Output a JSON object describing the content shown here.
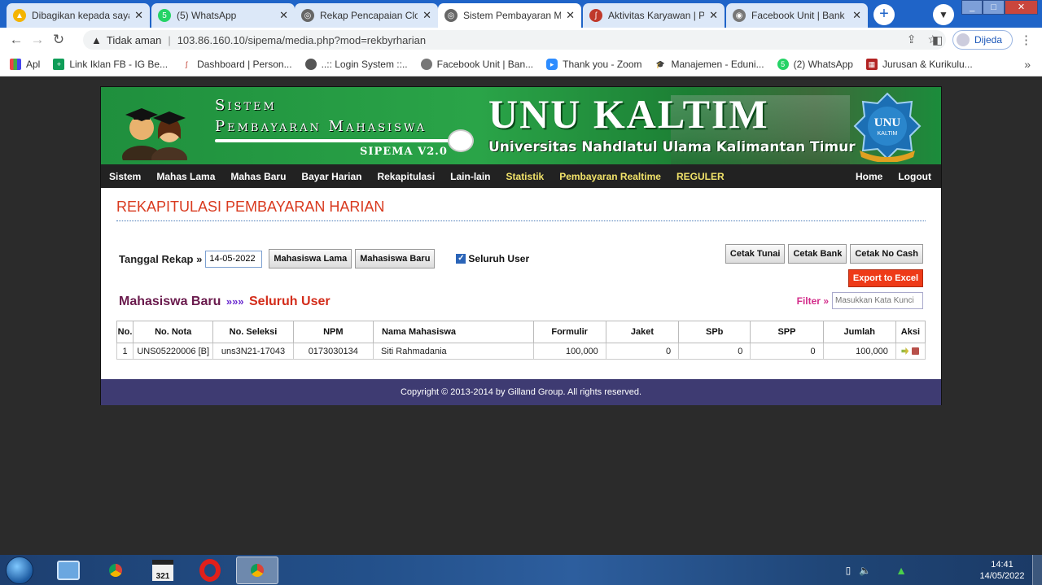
{
  "browser": {
    "tabs": [
      {
        "label": "Dibagikan kepada saya",
        "icon": "google-drive-icon"
      },
      {
        "label": "(5) WhatsApp",
        "icon": "whatsapp-icon"
      },
      {
        "label": "Rekap Pencapaian Clos",
        "icon": "globe-icon"
      },
      {
        "label": "Sistem Pembayaran Ma",
        "icon": "globe-icon"
      },
      {
        "label": "Aktivitas Karyawan | Pe",
        "icon": "bird-icon"
      },
      {
        "label": "Facebook Unit | Bank D",
        "icon": "facebook-unit-icon"
      }
    ],
    "security": "Tidak aman",
    "url": "103.86.160.10/sipema/media.php?mod=rekbyrharian",
    "profile": "Dijeda",
    "bookmarks": [
      {
        "label": "Apl",
        "icon": "apps-grid-icon"
      },
      {
        "label": "Link Iklan FB - IG Be...",
        "icon": "sheets-icon"
      },
      {
        "label": "Dashboard | Person...",
        "icon": "bird-icon"
      },
      {
        "label": "..:: Login System ::..",
        "icon": "globe-icon"
      },
      {
        "label": "Facebook Unit | Ban...",
        "icon": "facebook-unit-icon"
      },
      {
        "label": "Thank you - Zoom",
        "icon": "zoom-icon"
      },
      {
        "label": "Manajemen - Eduni...",
        "icon": "graduation-cap-icon"
      },
      {
        "label": "(2) WhatsApp",
        "icon": "whatsapp-icon"
      },
      {
        "label": "Jurusan & Kurikulu...",
        "icon": "school-icon"
      }
    ]
  },
  "banner": {
    "system_line1": "Sistem",
    "system_line2": "Pembayaran Mahasiswa",
    "version": "SIPEMA V2.0",
    "uni_title": "UNU KALTIM",
    "uni_subtitle": "Universitas Nahdlatul Ulama Kalimantan Timur",
    "logo_text": "UNU",
    "logo_sub": "KALTIM"
  },
  "nav": {
    "left": [
      "Sistem",
      "Mahas Lama",
      "Mahas Baru",
      "Bayar Harian",
      "Rekapitulasi",
      "Lain-lain"
    ],
    "highlight": [
      "Statistik",
      "Pembayaran Realtime",
      "REGULER"
    ],
    "right": [
      "Home",
      "Logout"
    ]
  },
  "page": {
    "title": "REKAPITULASI PEMBAYARAN HARIAN",
    "date_label": "Tanggal Rekap »",
    "date_value": "14-05-2022",
    "btn_lama": "Mahasiswa Lama",
    "btn_baru": "Mahasiswa Baru",
    "checkbox_label": "Seluruh User",
    "checkbox_checked": true,
    "cetak_tunai": "Cetak Tunai",
    "cetak_bank": "Cetak Bank",
    "cetak_nocash": "Cetak No Cash",
    "export_excel": "Export to Excel",
    "subheading_a": "Mahasiswa Baru",
    "subheading_arrows": "»»»",
    "subheading_b": "Seluruh User",
    "filter_label": "Filter »",
    "filter_placeholder": "Masukkan Kata Kunci"
  },
  "table": {
    "headers": [
      "No.",
      "No. Nota",
      "No. Seleksi",
      "NPM",
      "Nama Mahasiswa",
      "Formulir",
      "Jaket",
      "SPb",
      "SPP",
      "Jumlah",
      "Aksi"
    ],
    "rows": [
      {
        "no": "1",
        "nota": "UNS05220006 [B]",
        "seleksi": "uns3N21-17043",
        "npm": "0173030134",
        "nama": "Siti Rahmadania",
        "formulir": "100,000",
        "jaket": "0",
        "spb": "0",
        "spp": "0",
        "jumlah": "100,000"
      }
    ]
  },
  "footer": {
    "text": "Copyright © 2013-2014 by Gilland Group. All rights reserved."
  },
  "taskbar": {
    "apps": [
      "ie-icon",
      "chrome-icon",
      "calendar-icon",
      "opera-icon",
      "chrome-icon"
    ],
    "time": "14:41",
    "date": "14/05/2022"
  },
  "colors": {
    "banner_green": "#1f8f3d",
    "nav_bg": "#222222",
    "title_red": "#d93a1f",
    "footer_purple": "#3e3b72",
    "excel_red": "#ee3a18"
  }
}
